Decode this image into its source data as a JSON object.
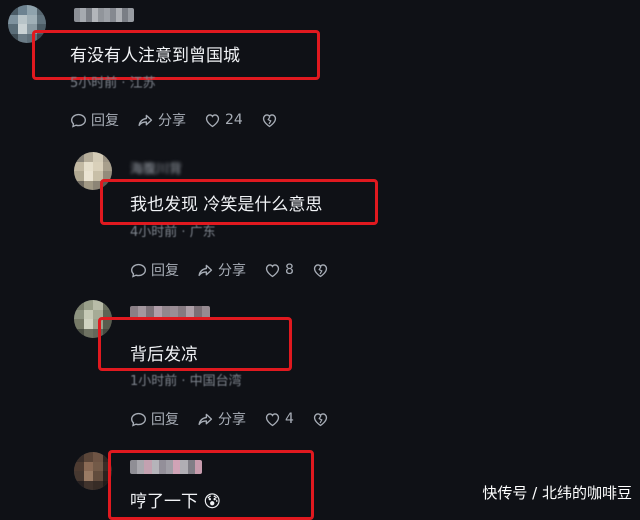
{
  "comments": [
    {
      "text": "有没有人注意到曾国城",
      "meta": "5小时前 · 江苏",
      "reply_label": "回复",
      "share_label": "分享",
      "like_count": "24"
    },
    {
      "username": "海腹川背",
      "text": "我也发现 冷笑是什么意思",
      "meta": "4小时前 · 广东",
      "reply_label": "回复",
      "share_label": "分享",
      "like_count": "8"
    },
    {
      "text": "背后发凉",
      "meta": "1小时前 · 中国台湾",
      "reply_label": "回复",
      "share_label": "分享",
      "like_count": "4"
    },
    {
      "text": "哼了一下",
      "emoji": "😰"
    }
  ],
  "watermark": "快传号 / 北纬的咖啡豆",
  "colors": {
    "background": "#0f1116",
    "highlight_box": "#e0191f",
    "meta_text": "#7d838c",
    "action_text": "#a7adb6"
  },
  "icons": [
    "reply-icon",
    "share-icon",
    "heart-icon",
    "dislike-icon"
  ]
}
